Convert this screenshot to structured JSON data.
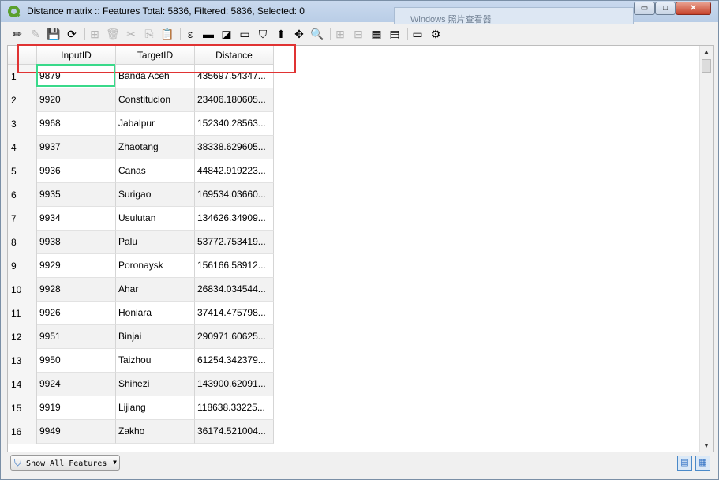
{
  "window": {
    "title": "Distance matrix :: Features Total: 5836, Filtered: 5836, Selected: 0",
    "minimize": "▭",
    "maximize": "□",
    "close": "✕",
    "background_title": "Windows 照片查看器"
  },
  "toolbar": {
    "icons": [
      "toggle-edit-icon",
      "multi-edit-icon",
      "save-edits-icon",
      "reload-icon",
      "add-feature-icon",
      "delete-feature-icon",
      "cut-icon",
      "copy-icon",
      "paste-icon",
      "select-expression-icon",
      "select-all-icon",
      "invert-selection-icon",
      "deselect-all-icon",
      "filter-icon",
      "move-selection-top-icon",
      "pan-to-selection-icon",
      "zoom-to-selection-icon",
      "new-field-icon",
      "delete-field-icon",
      "field-calculator-icon",
      "conditional-formatting-icon",
      "dock-table-icon",
      "actions-icon"
    ],
    "glyphs": [
      "✏",
      "✎",
      "💾",
      "⟳",
      "⊞",
      "🗑",
      "✂",
      "⎘",
      "📋",
      "ε",
      "▬",
      "◪",
      "▭",
      "⛉",
      "⬆",
      "✥",
      "🔍",
      "⊞",
      "⊟",
      "▦",
      "▤",
      "▭",
      "⚙"
    ]
  },
  "table": {
    "columns": [
      "InputID",
      "TargetID",
      "Distance"
    ],
    "rows": [
      {
        "n": "1",
        "input": "9879",
        "target": "Banda Aceh",
        "distance": "435697.54347..."
      },
      {
        "n": "2",
        "input": "9920",
        "target": "Constitucion",
        "distance": "23406.180605..."
      },
      {
        "n": "3",
        "input": "9968",
        "target": "Jabalpur",
        "distance": "152340.28563..."
      },
      {
        "n": "4",
        "input": "9937",
        "target": "Zhaotang",
        "distance": "38338.629605..."
      },
      {
        "n": "5",
        "input": "9936",
        "target": "Canas",
        "distance": "44842.919223..."
      },
      {
        "n": "6",
        "input": "9935",
        "target": "Surigao",
        "distance": "169534.03660..."
      },
      {
        "n": "7",
        "input": "9934",
        "target": "Usulutan",
        "distance": "134626.34909..."
      },
      {
        "n": "8",
        "input": "9938",
        "target": "Palu",
        "distance": "53772.753419..."
      },
      {
        "n": "9",
        "input": "9929",
        "target": "Poronaysk",
        "distance": "156166.58912..."
      },
      {
        "n": "10",
        "input": "9928",
        "target": "Ahar",
        "distance": "26834.034544..."
      },
      {
        "n": "11",
        "input": "9926",
        "target": "Honiara",
        "distance": "37414.475798..."
      },
      {
        "n": "12",
        "input": "9951",
        "target": "Binjai",
        "distance": "290971.60625..."
      },
      {
        "n": "13",
        "input": "9950",
        "target": "Taizhou",
        "distance": "61254.342379..."
      },
      {
        "n": "14",
        "input": "9924",
        "target": "Shihezi",
        "distance": "143900.62091..."
      },
      {
        "n": "15",
        "input": "9919",
        "target": "Lijiang",
        "distance": "118638.33225..."
      },
      {
        "n": "16",
        "input": "9949",
        "target": "Zakho",
        "distance": "36174.521004..."
      }
    ]
  },
  "bottom": {
    "show_all_label": "Show All Features",
    "form_view_icon": "form-view-icon",
    "table_view_icon": "table-view-icon"
  },
  "colors": {
    "highlight_red": "#e03333",
    "selection_green": "#39d98a"
  }
}
